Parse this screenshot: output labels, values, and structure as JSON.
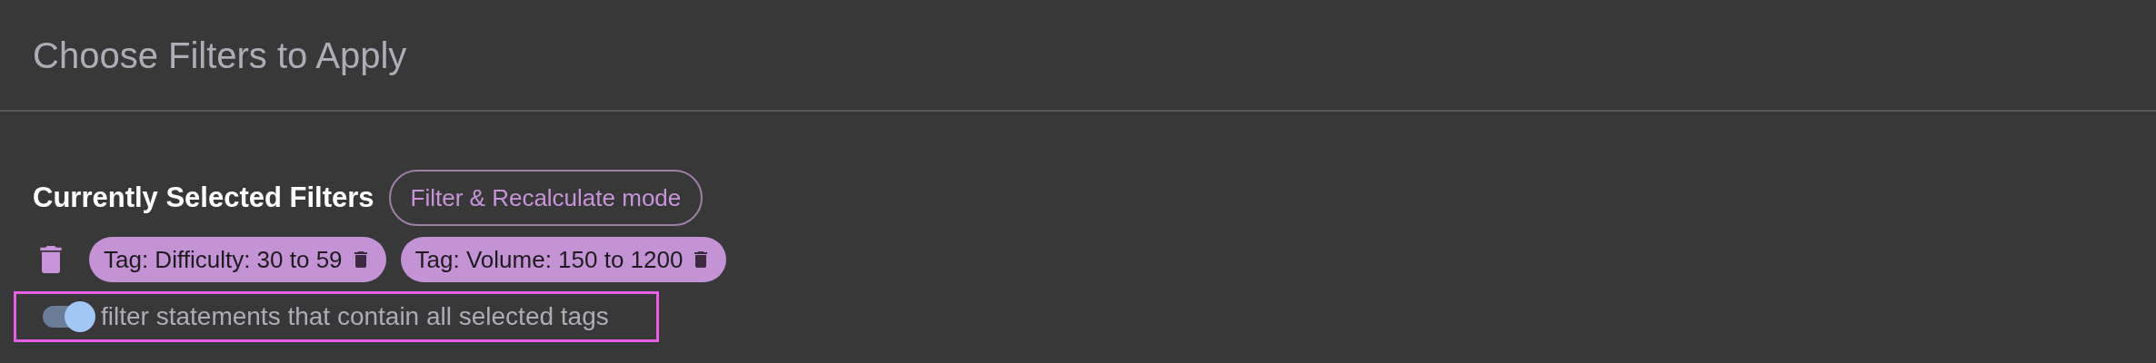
{
  "title": "Choose Filters to Apply",
  "section": {
    "heading": "Currently Selected Filters",
    "mode_button": "Filter & Recalculate mode"
  },
  "filters": [
    {
      "label": "Tag: Difficulty: 30 to 59"
    },
    {
      "label": "Tag: Volume: 150 to 1200"
    }
  ],
  "toggle": {
    "on": true,
    "label": "filter statements that contain all selected tags"
  }
}
